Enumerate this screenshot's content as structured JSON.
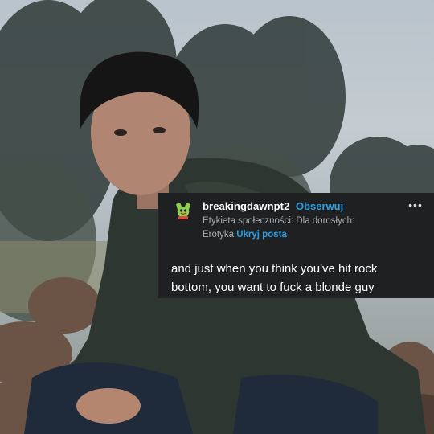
{
  "post": {
    "username": "breakingdawnpt2",
    "follow_label": "Obserwuj",
    "tag_line_1": "Etykieta społeczności: Dla dorosłych:",
    "tag_line_2": "Erotyka",
    "hide_label": "Ukryj posta",
    "more_icon": "ellipsis-icon",
    "avatar_icon": "avatar",
    "text_line_1": "and just when you think you've hit rock",
    "text_line_2": "bottom, you want to fuck a blonde guy"
  },
  "colors": {
    "post_bg": "#1e2021",
    "accent": "#2ea0e4",
    "muted": "#a9adb0"
  }
}
